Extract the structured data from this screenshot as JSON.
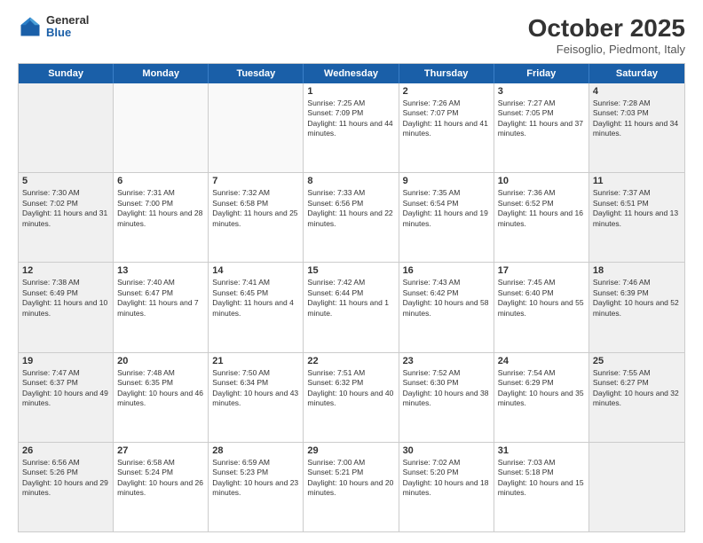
{
  "logo": {
    "general": "General",
    "blue": "Blue"
  },
  "header": {
    "month": "October 2025",
    "location": "Feisoglio, Piedmont, Italy"
  },
  "days": [
    "Sunday",
    "Monday",
    "Tuesday",
    "Wednesday",
    "Thursday",
    "Friday",
    "Saturday"
  ],
  "weeks": [
    [
      {
        "day": "",
        "empty": true
      },
      {
        "day": "",
        "empty": true
      },
      {
        "day": "",
        "empty": true
      },
      {
        "day": "1",
        "sunrise": "7:25 AM",
        "sunset": "7:09 PM",
        "daylight": "11 hours and 44 minutes."
      },
      {
        "day": "2",
        "sunrise": "7:26 AM",
        "sunset": "7:07 PM",
        "daylight": "11 hours and 41 minutes."
      },
      {
        "day": "3",
        "sunrise": "7:27 AM",
        "sunset": "7:05 PM",
        "daylight": "11 hours and 37 minutes."
      },
      {
        "day": "4",
        "sunrise": "7:28 AM",
        "sunset": "7:03 PM",
        "daylight": "11 hours and 34 minutes."
      }
    ],
    [
      {
        "day": "5",
        "sunrise": "7:30 AM",
        "sunset": "7:02 PM",
        "daylight": "11 hours and 31 minutes."
      },
      {
        "day": "6",
        "sunrise": "7:31 AM",
        "sunset": "7:00 PM",
        "daylight": "11 hours and 28 minutes."
      },
      {
        "day": "7",
        "sunrise": "7:32 AM",
        "sunset": "6:58 PM",
        "daylight": "11 hours and 25 minutes."
      },
      {
        "day": "8",
        "sunrise": "7:33 AM",
        "sunset": "6:56 PM",
        "daylight": "11 hours and 22 minutes."
      },
      {
        "day": "9",
        "sunrise": "7:35 AM",
        "sunset": "6:54 PM",
        "daylight": "11 hours and 19 minutes."
      },
      {
        "day": "10",
        "sunrise": "7:36 AM",
        "sunset": "6:52 PM",
        "daylight": "11 hours and 16 minutes."
      },
      {
        "day": "11",
        "sunrise": "7:37 AM",
        "sunset": "6:51 PM",
        "daylight": "11 hours and 13 minutes."
      }
    ],
    [
      {
        "day": "12",
        "sunrise": "7:38 AM",
        "sunset": "6:49 PM",
        "daylight": "11 hours and 10 minutes."
      },
      {
        "day": "13",
        "sunrise": "7:40 AM",
        "sunset": "6:47 PM",
        "daylight": "11 hours and 7 minutes."
      },
      {
        "day": "14",
        "sunrise": "7:41 AM",
        "sunset": "6:45 PM",
        "daylight": "11 hours and 4 minutes."
      },
      {
        "day": "15",
        "sunrise": "7:42 AM",
        "sunset": "6:44 PM",
        "daylight": "11 hours and 1 minute."
      },
      {
        "day": "16",
        "sunrise": "7:43 AM",
        "sunset": "6:42 PM",
        "daylight": "10 hours and 58 minutes."
      },
      {
        "day": "17",
        "sunrise": "7:45 AM",
        "sunset": "6:40 PM",
        "daylight": "10 hours and 55 minutes."
      },
      {
        "day": "18",
        "sunrise": "7:46 AM",
        "sunset": "6:39 PM",
        "daylight": "10 hours and 52 minutes."
      }
    ],
    [
      {
        "day": "19",
        "sunrise": "7:47 AM",
        "sunset": "6:37 PM",
        "daylight": "10 hours and 49 minutes."
      },
      {
        "day": "20",
        "sunrise": "7:48 AM",
        "sunset": "6:35 PM",
        "daylight": "10 hours and 46 minutes."
      },
      {
        "day": "21",
        "sunrise": "7:50 AM",
        "sunset": "6:34 PM",
        "daylight": "10 hours and 43 minutes."
      },
      {
        "day": "22",
        "sunrise": "7:51 AM",
        "sunset": "6:32 PM",
        "daylight": "10 hours and 40 minutes."
      },
      {
        "day": "23",
        "sunrise": "7:52 AM",
        "sunset": "6:30 PM",
        "daylight": "10 hours and 38 minutes."
      },
      {
        "day": "24",
        "sunrise": "7:54 AM",
        "sunset": "6:29 PM",
        "daylight": "10 hours and 35 minutes."
      },
      {
        "day": "25",
        "sunrise": "7:55 AM",
        "sunset": "6:27 PM",
        "daylight": "10 hours and 32 minutes."
      }
    ],
    [
      {
        "day": "26",
        "sunrise": "6:56 AM",
        "sunset": "5:26 PM",
        "daylight": "10 hours and 29 minutes."
      },
      {
        "day": "27",
        "sunrise": "6:58 AM",
        "sunset": "5:24 PM",
        "daylight": "10 hours and 26 minutes."
      },
      {
        "day": "28",
        "sunrise": "6:59 AM",
        "sunset": "5:23 PM",
        "daylight": "10 hours and 23 minutes."
      },
      {
        "day": "29",
        "sunrise": "7:00 AM",
        "sunset": "5:21 PM",
        "daylight": "10 hours and 20 minutes."
      },
      {
        "day": "30",
        "sunrise": "7:02 AM",
        "sunset": "5:20 PM",
        "daylight": "10 hours and 18 minutes."
      },
      {
        "day": "31",
        "sunrise": "7:03 AM",
        "sunset": "5:18 PM",
        "daylight": "10 hours and 15 minutes."
      },
      {
        "day": "",
        "empty": true
      }
    ]
  ]
}
